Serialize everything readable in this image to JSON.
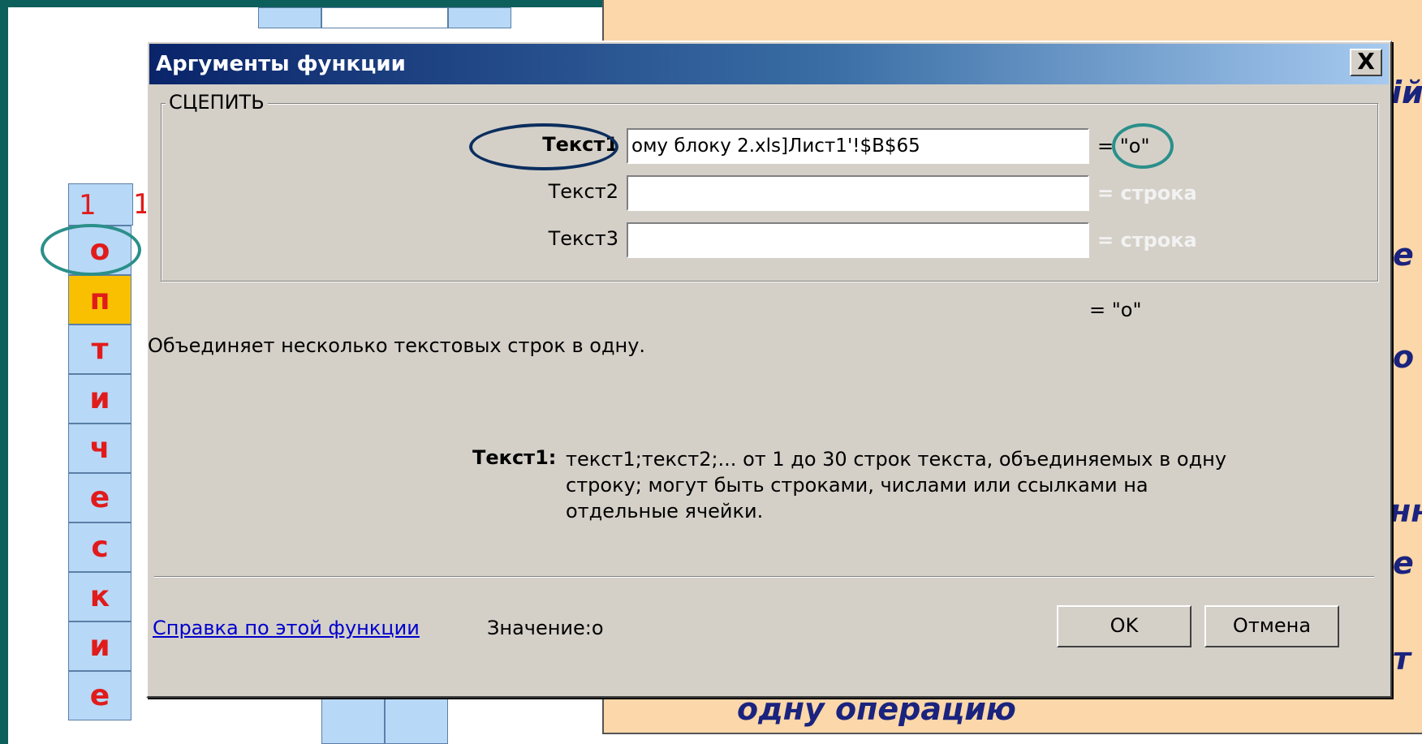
{
  "background": {
    "crossword": {
      "number_labels": [
        "1",
        "1"
      ],
      "letters": [
        "о",
        "п",
        "т",
        "и",
        "ч",
        "е",
        "с",
        "к",
        "и",
        "е"
      ],
      "highlighted_index": 1
    },
    "slide_text": {
      "bottom_line": "одну операцию",
      "right_fragments": [
        "ій",
        "е",
        "о",
        "нн",
        "е",
        "т"
      ]
    }
  },
  "dialog": {
    "title": "Аргументы функции",
    "close_label": "X",
    "function_name": "СЦЕПИТЬ",
    "arguments": [
      {
        "label": "Текст1",
        "value": "ому блоку 2.xls]Лист1'!$B$65",
        "result": "= \"о\""
      },
      {
        "label": "Текст2",
        "value": "",
        "result": "= строка"
      },
      {
        "label": "Текст3",
        "value": "",
        "result": "= строка"
      }
    ],
    "total_result": "= \"о\"",
    "description": "Объединяет несколько текстовых строк в одну.",
    "arg_desc_label": "Текст1:",
    "arg_desc_text": "текст1;текст2;... от 1 до 30 строк текста, объединяемых в одну строку; могут быть строками, числами или ссылками на отдельные ячейки.",
    "help_link": "Справка по этой функции",
    "value_label": "Значение:",
    "value": "о",
    "ok_label": "OK",
    "cancel_label": "Отмена"
  },
  "colors": {
    "slide_frame": "#0d5f5c",
    "crossword_cell": "#b7d8f7",
    "crossword_highlight": "#f8c000",
    "crossword_letter": "#e11b1b",
    "orange_panel": "#fbd7a9",
    "annotation_dark": "#0b2e5e",
    "annotation_teal": "#2b8f8a"
  }
}
